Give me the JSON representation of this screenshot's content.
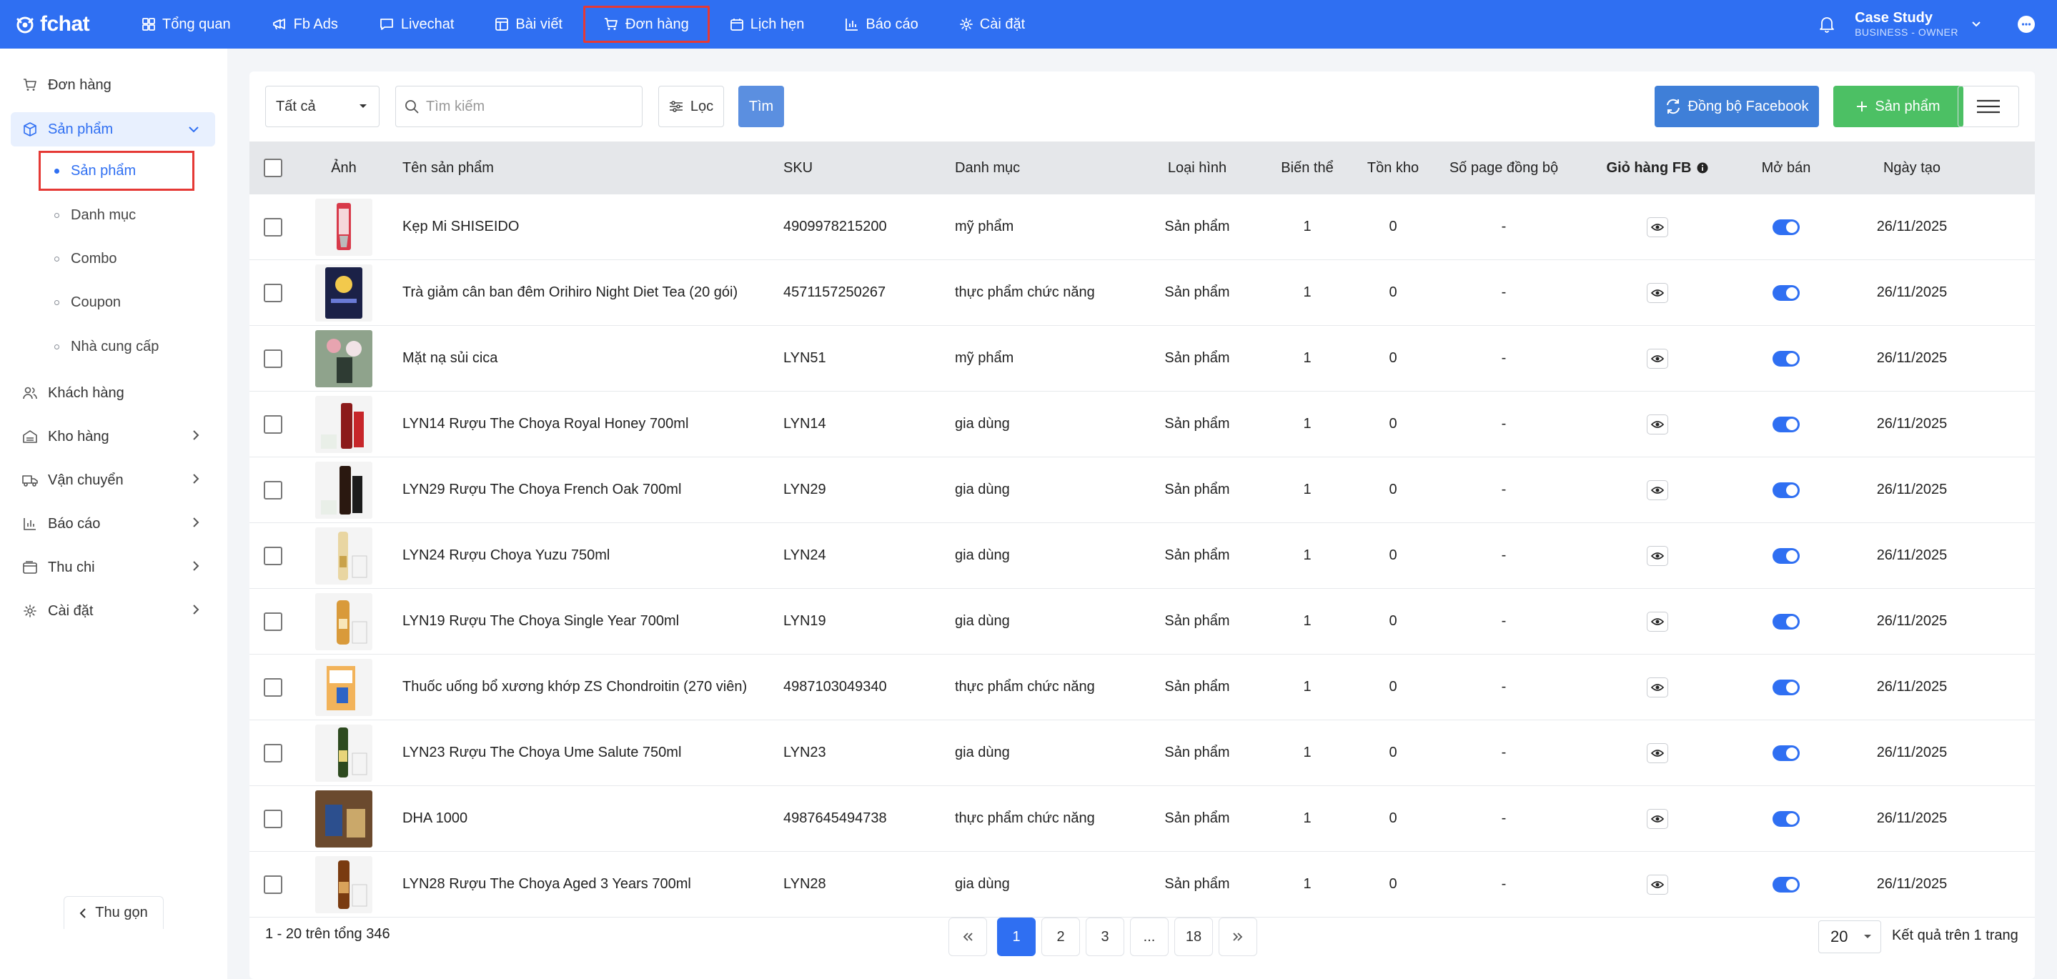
{
  "brand": {
    "name": "fchat",
    "primary_color": "#2f6ff2"
  },
  "topnav": {
    "items": [
      {
        "label": "Tổng quan",
        "icon": "dashboard-icon"
      },
      {
        "label": "Fb Ads",
        "icon": "megaphone-icon"
      },
      {
        "label": "Livechat",
        "icon": "chat-icon"
      },
      {
        "label": "Bài viết",
        "icon": "posts-icon"
      },
      {
        "label": "Đơn hàng",
        "icon": "cart-icon"
      },
      {
        "label": "Lịch hẹn",
        "icon": "calendar-icon"
      },
      {
        "label": "Báo cáo",
        "icon": "chart-icon"
      },
      {
        "label": "Cài đặt",
        "icon": "gear-icon"
      }
    ],
    "account_name": "Case Study",
    "account_role": "BUSINESS - OWNER"
  },
  "sidebar": {
    "items": [
      {
        "label": "Đơn hàng",
        "icon": "cart-icon"
      },
      {
        "label": "Sản phẩm",
        "icon": "box-icon"
      },
      {
        "label": "Khách hàng",
        "icon": "users-icon"
      },
      {
        "label": "Kho hàng",
        "icon": "warehouse-icon"
      },
      {
        "label": "Vận chuyển",
        "icon": "truck-icon"
      },
      {
        "label": "Báo cáo",
        "icon": "chart-icon"
      },
      {
        "label": "Thu chi",
        "icon": "wallet-icon"
      },
      {
        "label": "Cài đặt",
        "icon": "gear-icon"
      }
    ],
    "sub_items": [
      "Sản phẩm",
      "Danh mục",
      "Combo",
      "Coupon",
      "Nhà cung cấp"
    ],
    "collapse_label": "Thu gọn"
  },
  "toolbar": {
    "filter_value": "Tất cả",
    "search_placeholder": "Tìm kiếm",
    "filter_label": "Lọc",
    "find_label": "Tìm",
    "sync_label": "Đồng bộ Facebook",
    "add_label": "Sản phẩm"
  },
  "table": {
    "columns": [
      "Ảnh",
      "Tên sản phẩm",
      "SKU",
      "Danh mục",
      "Loại hình",
      "Biến thể",
      "Tồn kho",
      "Số page đồng bộ",
      "Giỏ hàng FB",
      "Mở bán",
      "Ngày tạo"
    ],
    "rows": [
      {
        "name": "Kẹp Mi SHISEIDO",
        "sku": "4909978215200",
        "category": "mỹ phẩm",
        "type": "Sản phẩm",
        "variants": "1",
        "stock": "0",
        "pages": "-",
        "created": "26/11/2025",
        "on_sale": true
      },
      {
        "name": "Trà giảm cân ban đêm Orihiro Night Diet Tea (20 gói)",
        "sku": "4571157250267",
        "category": "thực phẩm chức năng",
        "type": "Sản phẩm",
        "variants": "1",
        "stock": "0",
        "pages": "-",
        "created": "26/11/2025",
        "on_sale": true
      },
      {
        "name": "Mặt nạ sủi cica",
        "sku": "LYN51",
        "category": "mỹ phẩm",
        "type": "Sản phẩm",
        "variants": "1",
        "stock": "0",
        "pages": "-",
        "created": "26/11/2025",
        "on_sale": true
      },
      {
        "name": "LYN14 Rượu The Choya Royal Honey 700ml",
        "sku": "LYN14",
        "category": "gia dùng",
        "type": "Sản phẩm",
        "variants": "1",
        "stock": "0",
        "pages": "-",
        "created": "26/11/2025",
        "on_sale": true
      },
      {
        "name": "LYN29 Rượu The Choya French Oak 700ml",
        "sku": "LYN29",
        "category": "gia dùng",
        "type": "Sản phẩm",
        "variants": "1",
        "stock": "0",
        "pages": "-",
        "created": "26/11/2025",
        "on_sale": true
      },
      {
        "name": "LYN24 Rượu Choya Yuzu 750ml",
        "sku": "LYN24",
        "category": "gia dùng",
        "type": "Sản phẩm",
        "variants": "1",
        "stock": "0",
        "pages": "-",
        "created": "26/11/2025",
        "on_sale": true
      },
      {
        "name": "LYN19 Rượu The Choya Single Year 700ml",
        "sku": "LYN19",
        "category": "gia dùng",
        "type": "Sản phẩm",
        "variants": "1",
        "stock": "0",
        "pages": "-",
        "created": "26/11/2025",
        "on_sale": true
      },
      {
        "name": "Thuốc uống bổ xương khớp ZS Chondroitin (270 viên)",
        "sku": "4987103049340",
        "category": "thực phẩm chức năng",
        "type": "Sản phẩm",
        "variants": "1",
        "stock": "0",
        "pages": "-",
        "created": "26/11/2025",
        "on_sale": true
      },
      {
        "name": "LYN23 Rượu The Choya Ume Salute 750ml",
        "sku": "LYN23",
        "category": "gia dùng",
        "type": "Sản phẩm",
        "variants": "1",
        "stock": "0",
        "pages": "-",
        "created": "26/11/2025",
        "on_sale": true
      },
      {
        "name": "DHA 1000",
        "sku": "4987645494738",
        "category": "thực phẩm chức năng",
        "type": "Sản phẩm",
        "variants": "1",
        "stock": "0",
        "pages": "-",
        "created": "26/11/2025",
        "on_sale": true
      },
      {
        "name": "LYN28 Rượu The Choya Aged 3 Years 700ml",
        "sku": "LYN28",
        "category": "gia dùng",
        "type": "Sản phẩm",
        "variants": "1",
        "stock": "0",
        "pages": "-",
        "created": "26/11/2025",
        "on_sale": true
      }
    ]
  },
  "footer": {
    "summary": "1 - 20 trên tổng 346",
    "pages": [
      "1",
      "2",
      "3",
      "...",
      "18"
    ],
    "current_page": "1",
    "per_page": "20",
    "per_page_label": "Kết quả trên 1 trang"
  }
}
